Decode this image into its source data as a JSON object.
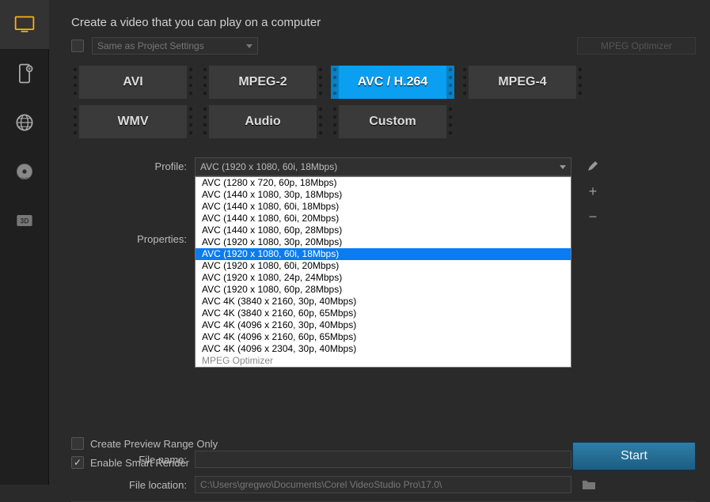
{
  "sidebar": {
    "items": [
      {
        "name": "computer",
        "active": true
      },
      {
        "name": "mobile",
        "active": false
      },
      {
        "name": "web",
        "active": false
      },
      {
        "name": "disc",
        "active": false
      },
      {
        "name": "3d",
        "active": false
      }
    ]
  },
  "header": {
    "title": "Create a video that you can play on a computer",
    "same_as_project_label": "Same as Project Settings",
    "mpeg_optimizer_label": "MPEG Optimizer"
  },
  "formats": [
    {
      "label": "AVI",
      "selected": false
    },
    {
      "label": "MPEG-2",
      "selected": false
    },
    {
      "label": "AVC / H.264",
      "selected": true
    },
    {
      "label": "MPEG-4",
      "selected": false
    },
    {
      "label": "WMV",
      "selected": false
    },
    {
      "label": "Audio",
      "selected": false
    },
    {
      "label": "Custom",
      "selected": false
    }
  ],
  "profile": {
    "label": "Profile:",
    "selected": "AVC (1920 x 1080, 60i, 18Mbps)",
    "options": [
      "AVC (1280 x 720, 60p, 18Mbps)",
      "AVC (1440 x 1080, 30p, 18Mbps)",
      "AVC (1440 x 1080, 60i, 18Mbps)",
      "AVC (1440 x 1080, 60i, 20Mbps)",
      "AVC (1440 x 1080, 60p, 28Mbps)",
      "AVC (1920 x 1080, 30p, 20Mbps)",
      "AVC (1920 x 1080, 60i, 18Mbps)",
      "AVC (1920 x 1080, 60i, 20Mbps)",
      "AVC (1920 x 1080, 24p, 24Mbps)",
      "AVC (1920 x 1080, 60p, 28Mbps)",
      "AVC 4K (3840 x 2160, 30p, 40Mbps)",
      "AVC 4K (3840 x 2160, 60p, 65Mbps)",
      "AVC 4K (4096 x 2160, 30p, 40Mbps)",
      "AVC 4K (4096 x 2160, 60p, 65Mbps)",
      "AVC 4K (4096 x 2304, 30p, 40Mbps)",
      "MPEG Optimizer"
    ],
    "highlight_index": 6
  },
  "properties": {
    "label": "Properties:"
  },
  "file": {
    "name_label": "File name:",
    "name_value": "",
    "location_label": "File location:",
    "location_value": "C:\\Users\\gregwo\\Documents\\Corel VideoStudio Pro\\17.0\\"
  },
  "options": {
    "preview_range_label": "Create Preview Range Only",
    "preview_range_checked": false,
    "smart_render_label": "Enable Smart Render",
    "smart_render_checked": true
  },
  "start_label": "Start"
}
